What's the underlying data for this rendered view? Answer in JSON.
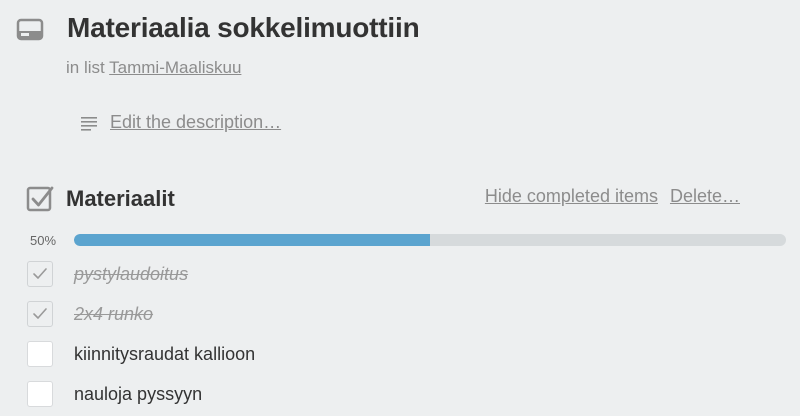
{
  "card": {
    "icon": "card-icon",
    "title": "Materiaalia sokkelimuottiin",
    "in_list_prefix": "in list",
    "list_name": "Tammi-Maaliskuu"
  },
  "description": {
    "icon": "description-lines-icon",
    "edit_label": "Edit the description…"
  },
  "checklist": {
    "icon": "checklist-icon",
    "title": "Materiaalit",
    "hide_completed_label": "Hide completed items",
    "delete_label": "Delete…",
    "progress_label": "50%",
    "progress_fraction": 0.5,
    "progress_color": "#5ba4cf",
    "items": [
      {
        "text": "pystylaudoitus",
        "checked": true
      },
      {
        "text": "2x4 runko",
        "checked": true
      },
      {
        "text": "kiinnitysraudat kallioon",
        "checked": false
      },
      {
        "text": "nauloja pyssyyn",
        "checked": false
      }
    ]
  }
}
